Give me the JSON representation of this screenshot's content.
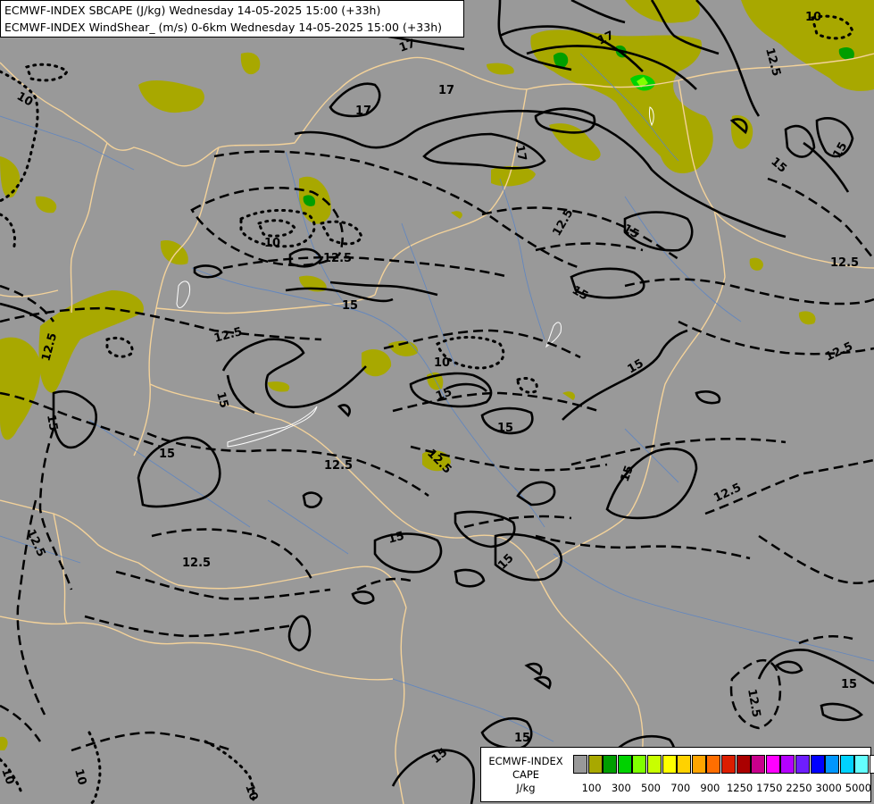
{
  "header": {
    "line1": "ECMWF-INDEX SBCAPE (J/kg) Wednesday 14-05-2025 15:00 (+33h)",
    "line2": "ECMWF-INDEX WindShear_ (m/s) 0-6km Wednesday 14-05-2025 15:00 (+33h)"
  },
  "map": {
    "background_color": "#999999",
    "border_color": "#f3d29a",
    "river_color": "#5b84c4",
    "contour_labels": [
      "10",
      "12.5",
      "15",
      "17"
    ]
  },
  "legend": {
    "title_line1": "ECMWF-INDEX",
    "title_line2": "CAPE",
    "title_line3": "J/kg",
    "colors": [
      "#999999",
      "#a8a800",
      "#009e00",
      "#00d200",
      "#7fff00",
      "#c8ff00",
      "#ffff00",
      "#ffd200",
      "#ffa500",
      "#ff6e00",
      "#dc1e00",
      "#aa0000",
      "#c8008c",
      "#ff00ff",
      "#b400ff",
      "#6e1eff",
      "#0000ff",
      "#0096ff",
      "#00d2ff",
      "#64ffff",
      "#ffffff"
    ],
    "tick_labels": [
      "100",
      "300",
      "500",
      "700",
      "900",
      "1250",
      "1750",
      "2250",
      "3000",
      "5000"
    ]
  }
}
